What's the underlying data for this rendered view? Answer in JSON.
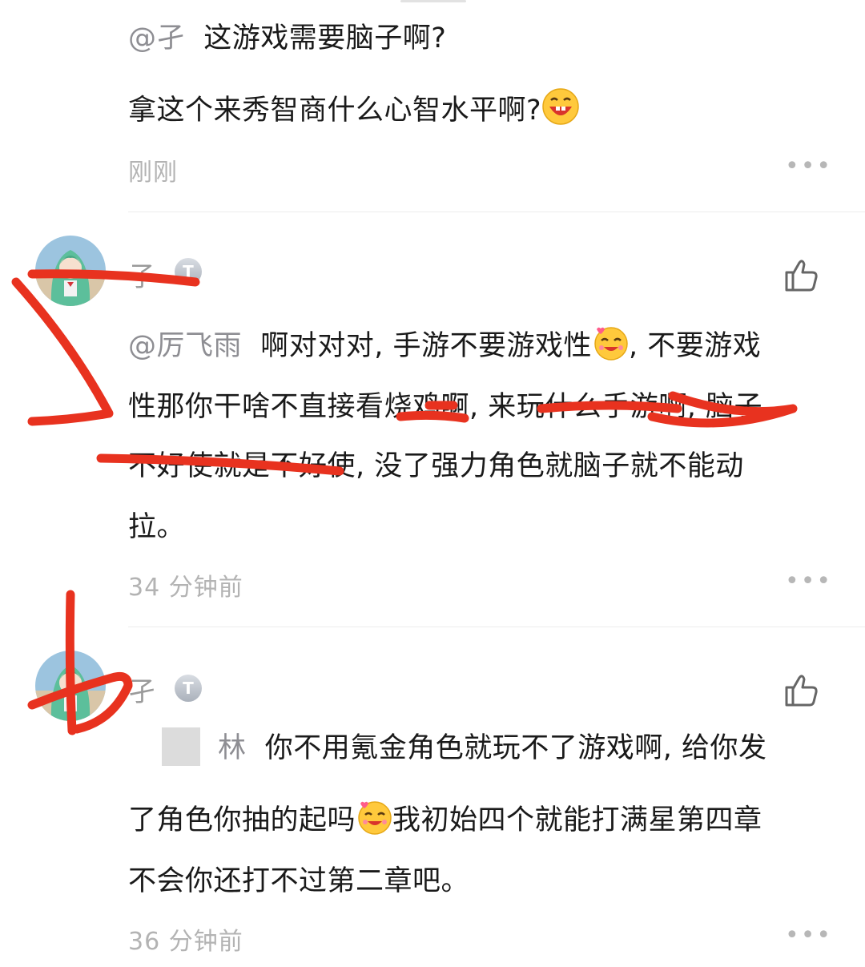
{
  "comments": [
    {
      "mention": "@孑",
      "text_line1": "这游戏需要脑子啊?",
      "text_line2": "拿这个来秀智商什么心智水平啊?",
      "emoji": "grinning-emoji",
      "time": "刚刚",
      "more": "•••"
    },
    {
      "username": "孑",
      "badge": "T",
      "mention": "@厉飞雨",
      "line1": "啊对对对, 手游不要游戏性",
      "line1b": ", 不要游戏",
      "line2": "性那你干啥不直接看烧鸡啊, 来玩什么手游啊, 脑子",
      "line3": "不好使就是不好使, 没了强力角色就脑子就不能动",
      "line4": "拉。",
      "emoji": "blushing-emoji",
      "time": "34 分钟前",
      "more": "•••"
    },
    {
      "username": "孑",
      "badge": "T",
      "mention": "林",
      "line1": "你不用氪金角色就玩不了游戏啊, 给你发",
      "line2a": "了角色你抽的起吗",
      "line2b": "我初始四个就能打满星第四章",
      "line3": "不会你还打不过第二章吧。",
      "emoji": "blushing-emoji",
      "time": "36 分钟前",
      "more": "•••"
    }
  ],
  "colors": {
    "scribble": "#e8321f",
    "meta_text": "#b3b3b3",
    "divider": "#ececec"
  }
}
